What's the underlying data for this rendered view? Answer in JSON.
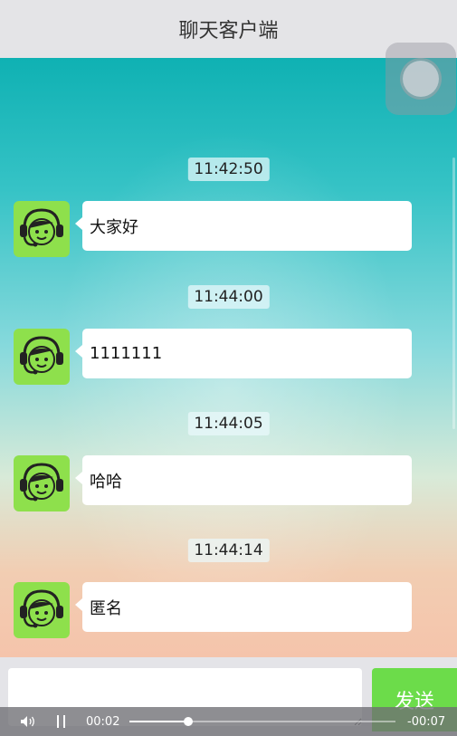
{
  "header": {
    "title": "聊天客户端"
  },
  "messages": [
    {
      "time": "11:42:50",
      "text": "大家好"
    },
    {
      "time": "11:44:00",
      "text": "1111111"
    },
    {
      "time": "11:44:05",
      "text": "哈哈"
    },
    {
      "time": "11:44:14",
      "text": "匿名"
    }
  ],
  "composer": {
    "input_value": "",
    "send_label": "发送"
  },
  "player": {
    "elapsed": "00:02",
    "remaining": "-00:07",
    "progress": 0.22
  },
  "icons": {
    "avatar": "headset-agent-avatar-icon",
    "volume": "speaker-icon",
    "pause": "pause-icon",
    "assist": "floating-assist-icon"
  },
  "colors": {
    "send_button": "#6cdc4a",
    "avatar_bg": "#8ee04c"
  }
}
